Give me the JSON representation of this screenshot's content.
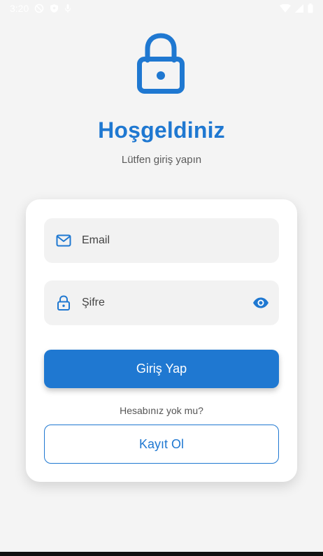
{
  "status_bar": {
    "time": "3:20",
    "icons": [
      "no-disturb-icon",
      "shield-icon",
      "mic-icon",
      "wifi-icon",
      "signal-icon",
      "battery-icon"
    ]
  },
  "hero": {
    "icon": "lock-icon",
    "title": "Hoşgeldiniz",
    "subtitle": "Lütfen giriş yapın"
  },
  "form": {
    "email": {
      "placeholder": "Email",
      "icon": "mail-icon"
    },
    "password": {
      "placeholder": "Şifre",
      "icon": "lock-icon",
      "toggle_icon": "eye-icon"
    },
    "login_label": "Giriş Yap",
    "prompt": "Hesabınız yok mu?",
    "register_label": "Kayıt Ol"
  },
  "colors": {
    "accent": "#1f78d1",
    "background": "#f4f4f4",
    "card": "#ffffff",
    "field": "#f2f2f2"
  }
}
